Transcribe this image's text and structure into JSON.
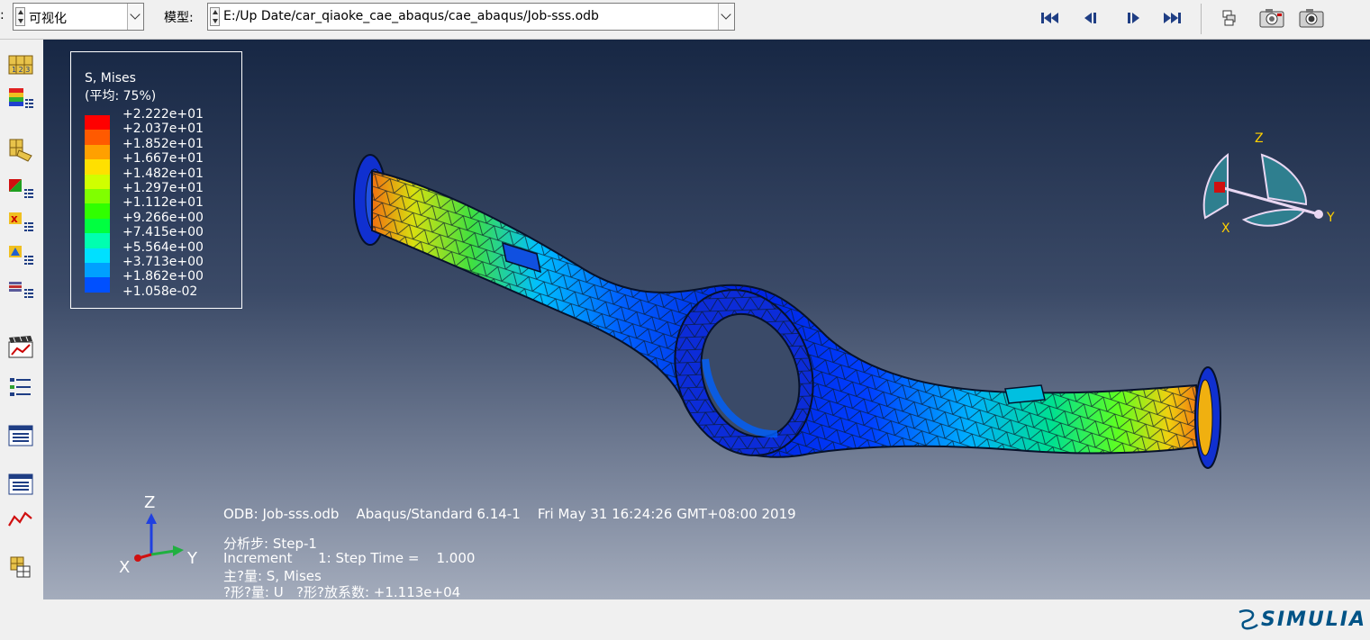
{
  "toolbar": {
    "module_label": ":",
    "module_value": "可视化",
    "model_label": "模型:",
    "model_value": "E:/Up Date/car_qiaoke_cae_abaqus/cae_abaqus/Job-sss.odb"
  },
  "legend": {
    "title1": "S, Mises",
    "title2": "(平均: 75%)",
    "values": [
      "+2.222e+01",
      "+2.037e+01",
      "+1.852e+01",
      "+1.667e+01",
      "+1.482e+01",
      "+1.297e+01",
      "+1.112e+01",
      "+9.266e+00",
      "+7.415e+00",
      "+5.564e+00",
      "+3.713e+00",
      "+1.862e+00",
      "+1.058e-02"
    ],
    "colors": [
      "#ff0000",
      "#ff5a00",
      "#ffa000",
      "#ffe000",
      "#d0ff00",
      "#80ff00",
      "#30ff00",
      "#00ff40",
      "#00ffb0",
      "#00e0ff",
      "#00a0ff",
      "#0050ff",
      "#0000ff"
    ]
  },
  "triad": {
    "x": "X",
    "y": "Y",
    "z": "Z"
  },
  "view_cube": {
    "x": "X",
    "y": "Y",
    "z": "Z"
  },
  "info": {
    "line1": "ODB: Job-sss.odb    Abaqus/Standard 6.14-1    Fri May 31 16:24:26 GMT+08:00 2019",
    "line2": "分析步: Step-1",
    "line3": "Increment      1: Step Time =    1.000",
    "line4": "主?量: S, Mises",
    "line5": "?形?量: U   ?形?放系数: +1.113e+04"
  },
  "brand": "SIMULIA",
  "colors": {
    "viewport_top": "#172744",
    "viewport_bottom": "#a4acbc",
    "brand": "#005386"
  }
}
